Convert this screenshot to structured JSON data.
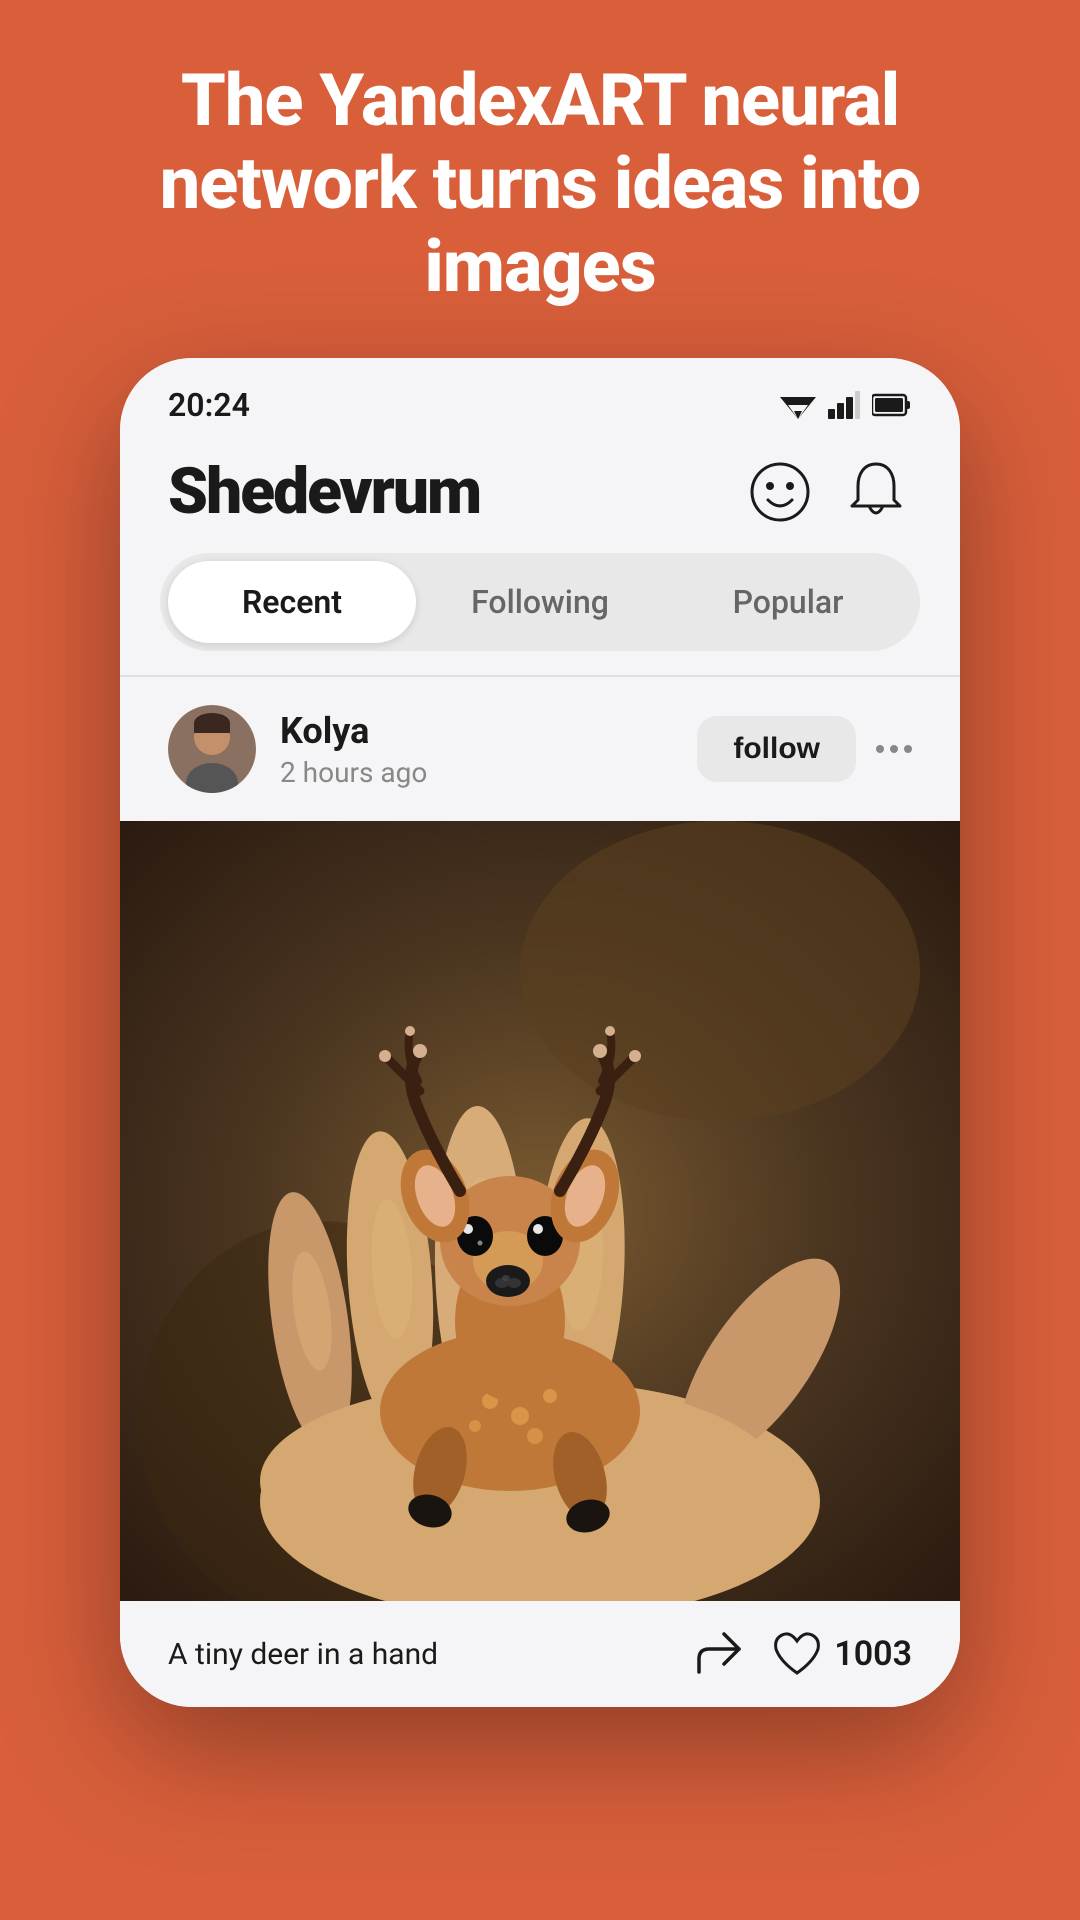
{
  "page": {
    "background_color": "#D95F3B",
    "headline": "The YandexART neural network turns ideas into images"
  },
  "status_bar": {
    "time": "20:24"
  },
  "app_header": {
    "title": "Shedevrum",
    "avatar_icon": "☺",
    "bell_icon": "🔔"
  },
  "tabs": {
    "items": [
      {
        "label": "Recent",
        "active": false
      },
      {
        "label": "Following",
        "active": true
      },
      {
        "label": "Popular",
        "active": false
      }
    ]
  },
  "post": {
    "username": "Kolya",
    "time": "2 hours ago",
    "follow_label": "follow",
    "caption": "A tiny deer in a hand",
    "like_count": "1003"
  }
}
